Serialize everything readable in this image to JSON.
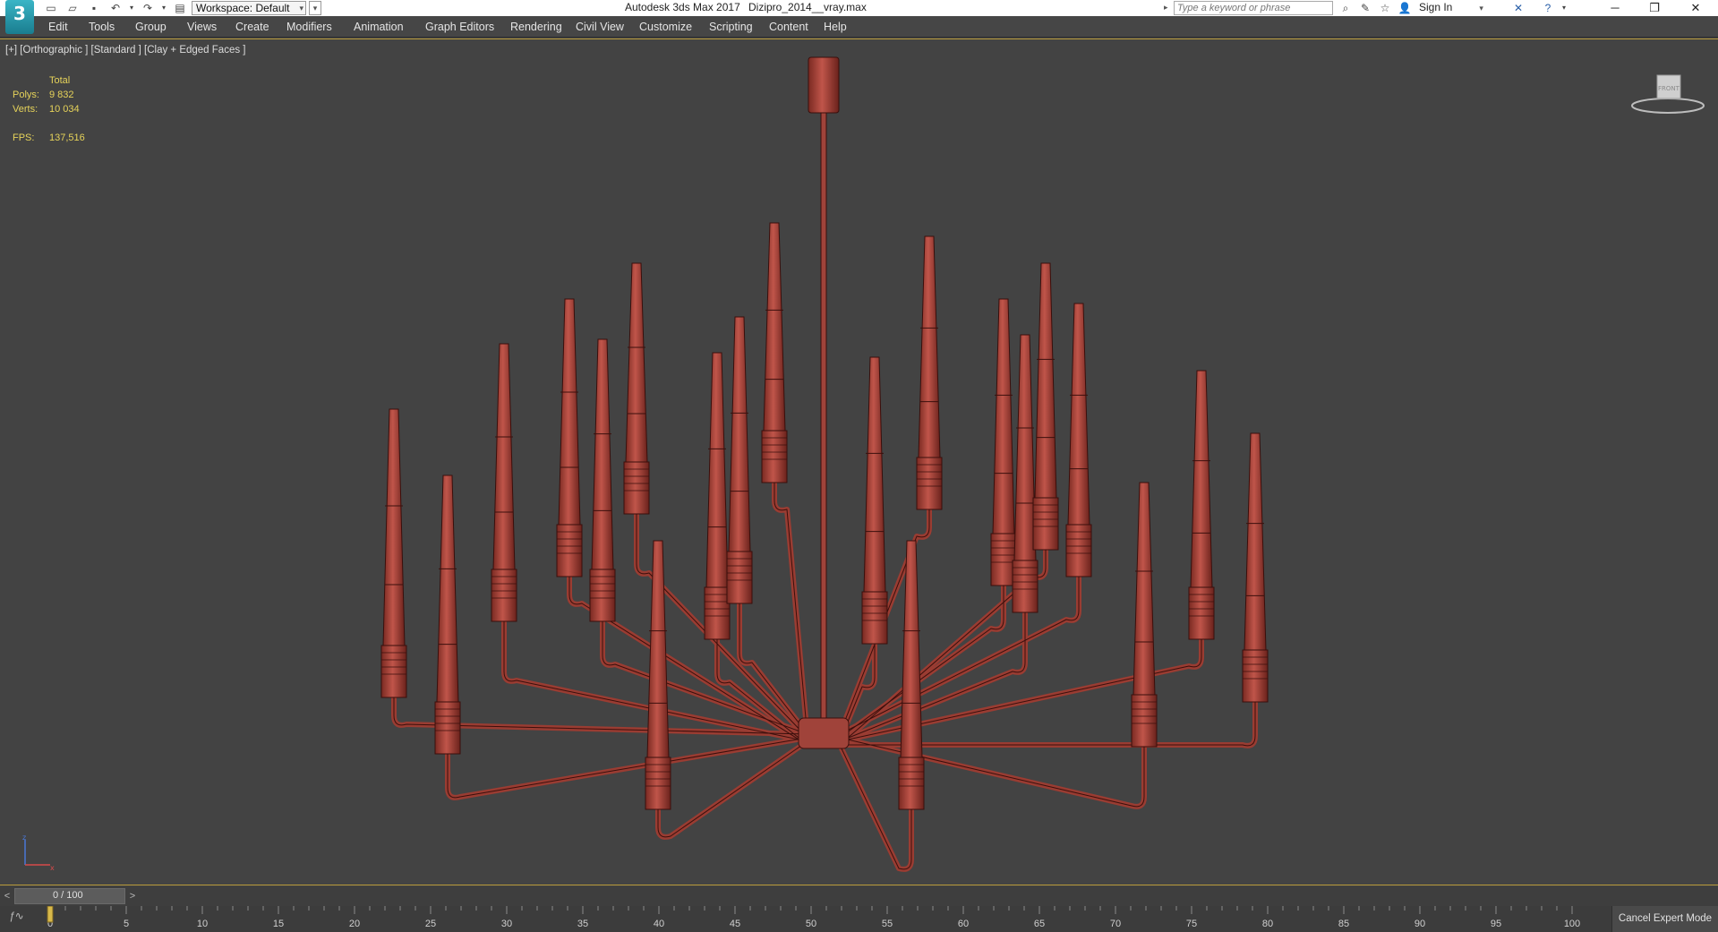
{
  "titlebar": {
    "app_title": "Autodesk 3ds Max 2017",
    "file_name": "Dizipro_2014__vray.max",
    "workspace": "Workspace: Default",
    "search_placeholder": "Type a keyword or phrase",
    "sign_in": "Sign In",
    "logo": "3"
  },
  "menu": [
    "Edit",
    "Tools",
    "Group",
    "Views",
    "Create",
    "Modifiers",
    "Animation",
    "Graph Editors",
    "Rendering",
    "Civil View",
    "Customize",
    "Scripting",
    "Content",
    "Help"
  ],
  "viewport": {
    "label": "[+] [Orthographic ] [Standard ] [Clay + Edged Faces ]",
    "stats": {
      "header": "Total",
      "polys_label": "Polys:",
      "polys_value": "9 832",
      "verts_label": "Verts:",
      "verts_value": "10 034",
      "fps_label": "FPS:",
      "fps_value": "137,516"
    },
    "viewcube_face": "FRONT",
    "model_color": "#b24a3e"
  },
  "timeline": {
    "frame_label": "0 / 100",
    "prev": "<",
    "next": ">",
    "ticks": [
      0,
      5,
      10,
      15,
      20,
      25,
      30,
      35,
      40,
      45,
      50,
      55,
      60,
      65,
      70,
      75,
      80,
      85,
      90,
      95,
      100
    ],
    "cancel_expert": "Cancel Expert Mode"
  },
  "colors": {
    "viewport_bg": "#434343",
    "accent_border": "#b89a3a",
    "stats_text": "#e6d35a"
  }
}
